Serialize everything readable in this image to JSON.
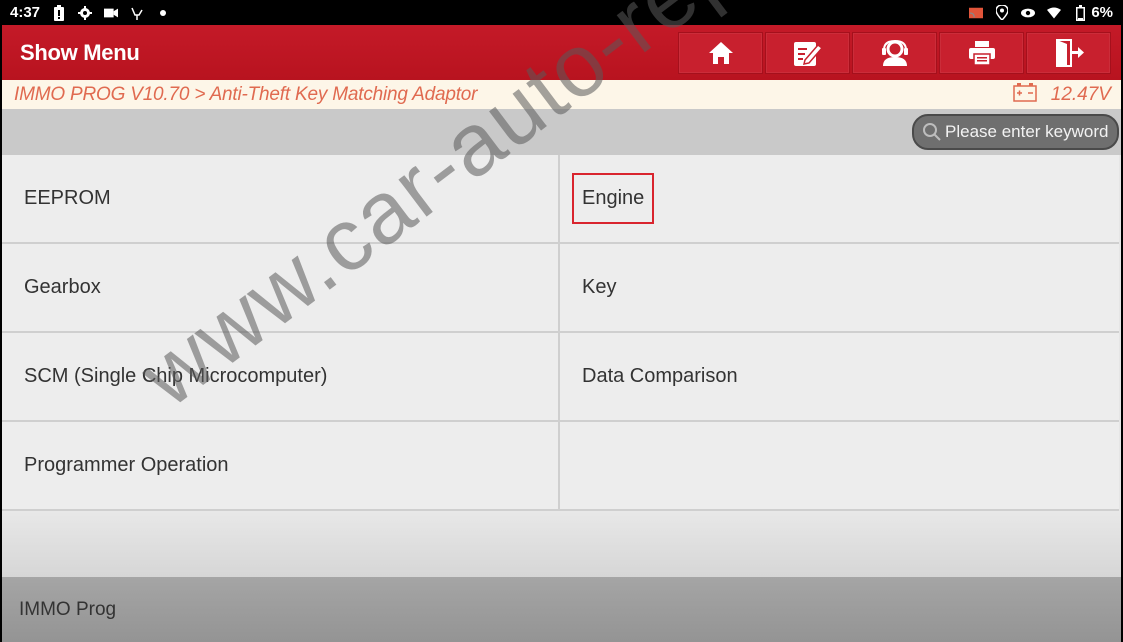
{
  "status_bar": {
    "time": "4:37",
    "left_icons": [
      "battery-alert-icon",
      "settings-icon",
      "video-icon",
      "usb-icon",
      "dot-icon"
    ],
    "right_icons": [
      "cast-icon",
      "location-icon",
      "eye-icon",
      "wifi-icon",
      "battery-icon"
    ],
    "battery_percent": "6%"
  },
  "header": {
    "title": "Show Menu",
    "toolbar": [
      {
        "name": "home",
        "icon": "home-icon"
      },
      {
        "name": "report",
        "icon": "edit-note-icon"
      },
      {
        "name": "support",
        "icon": "headset-user-icon"
      },
      {
        "name": "print",
        "icon": "printer-icon"
      },
      {
        "name": "exit",
        "icon": "exit-door-icon"
      }
    ]
  },
  "breadcrumb": {
    "path": "IMMO PROG V10.70 > Anti-Theft Key Matching Adaptor",
    "voltage": "12.47V",
    "accent_color": "#e06a50"
  },
  "search": {
    "placeholder": "Please enter keyword",
    "value": ""
  },
  "menu": {
    "items": [
      {
        "label": "EEPROM",
        "highlighted": false
      },
      {
        "label": "Engine",
        "highlighted": true
      },
      {
        "label": "Gearbox",
        "highlighted": false
      },
      {
        "label": "Key",
        "highlighted": false
      },
      {
        "label": "SCM (Single Chip Microcomputer)",
        "highlighted": false
      },
      {
        "label": "Data Comparison",
        "highlighted": false
      },
      {
        "label": "Programmer Operation",
        "highlighted": false
      },
      {
        "label": "",
        "highlighted": false
      }
    ],
    "highlight_color": "#d9242e"
  },
  "footer": {
    "label": "IMMO Prog"
  },
  "watermark": "www.car-auto-repair.com",
  "colors": {
    "header_red": "#c41a28",
    "breadcrumb_bg": "#fdf6e8"
  }
}
